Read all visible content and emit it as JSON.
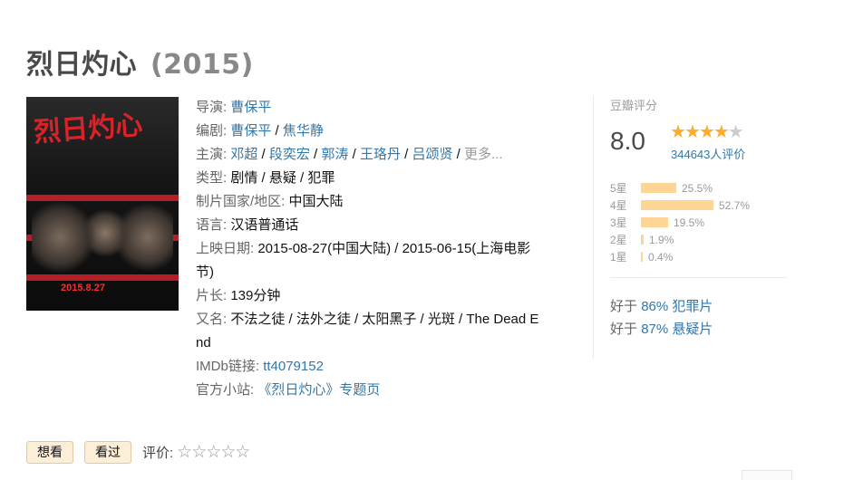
{
  "title": "烈日灼心",
  "year": "(2015)",
  "poster": {
    "title_art": "烈日灼心",
    "date": "2015.8.27"
  },
  "info": {
    "director_label": "导演:",
    "director": "曹保平",
    "writer_label": "编剧:",
    "writers": [
      "曹保平",
      "焦华静"
    ],
    "cast_label": "主演:",
    "cast": [
      "邓超",
      "段奕宏",
      "郭涛",
      "王珞丹",
      "吕颂贤"
    ],
    "cast_more": "更多...",
    "genre_label": "类型:",
    "genres": "剧情 / 悬疑 / 犯罪",
    "country_label": "制片国家/地区:",
    "country": "中国大陆",
    "language_label": "语言:",
    "language": "汉语普通话",
    "release_label": "上映日期:",
    "release_line1": "2015-08-27(中国大陆) / 2015-06-15(上海电影",
    "release_line2": "节)",
    "runtime_label": "片长:",
    "runtime": "139分钟",
    "aka_label": "又名:",
    "aka_line1": "不法之徒 / 法外之徒 / 太阳黑子 / 光斑 / The Dead E",
    "aka_line2": "nd",
    "imdb_label": "IMDb链接:",
    "imdb": "tt4079152",
    "site_label": "官方小站:",
    "site": "《烈日灼心》专题页"
  },
  "rating": {
    "label": "豆瓣评分",
    "score": "8.0",
    "stars_filled": 4,
    "votes": "344643人评价",
    "bars": [
      {
        "label": "5星",
        "percent": 25.5,
        "text": "25.5%"
      },
      {
        "label": "4星",
        "percent": 52.7,
        "text": "52.7%"
      },
      {
        "label": "3星",
        "percent": 19.5,
        "text": "19.5%"
      },
      {
        "label": "2星",
        "percent": 1.9,
        "text": "1.9%"
      },
      {
        "label": "1星",
        "percent": 0.4,
        "text": "0.4%"
      }
    ],
    "better_than": [
      {
        "prefix": "好于",
        "value": "86% 犯罪片"
      },
      {
        "prefix": "好于",
        "value": "87% 悬疑片"
      }
    ]
  },
  "actions": {
    "want": "想看",
    "seen": "看过",
    "rate_label": "评价:",
    "rate_stars": "☆☆☆☆☆"
  },
  "colors": {
    "link": "#3377aa",
    "bar": "#ffd596",
    "star": "#ffac2d",
    "button_bg": "#fdeed8"
  }
}
